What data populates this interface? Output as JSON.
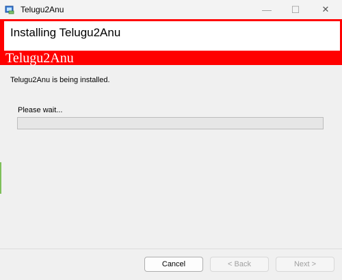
{
  "window": {
    "title": "Telugu2Anu",
    "icon": "installer-icon",
    "controls": {
      "minimize": "—",
      "maximize": "☐",
      "close": "✕"
    }
  },
  "banner": {
    "heading": "Installing Telugu2Anu",
    "product_name": "Telugu2Anu",
    "accent_color": "#ff0000"
  },
  "body": {
    "status_text": "Telugu2Anu is being installed.",
    "wait_label": "Please wait...",
    "progress_fraction": 0
  },
  "buttons": {
    "cancel": "Cancel",
    "back": "< Back",
    "next": "Next >"
  }
}
